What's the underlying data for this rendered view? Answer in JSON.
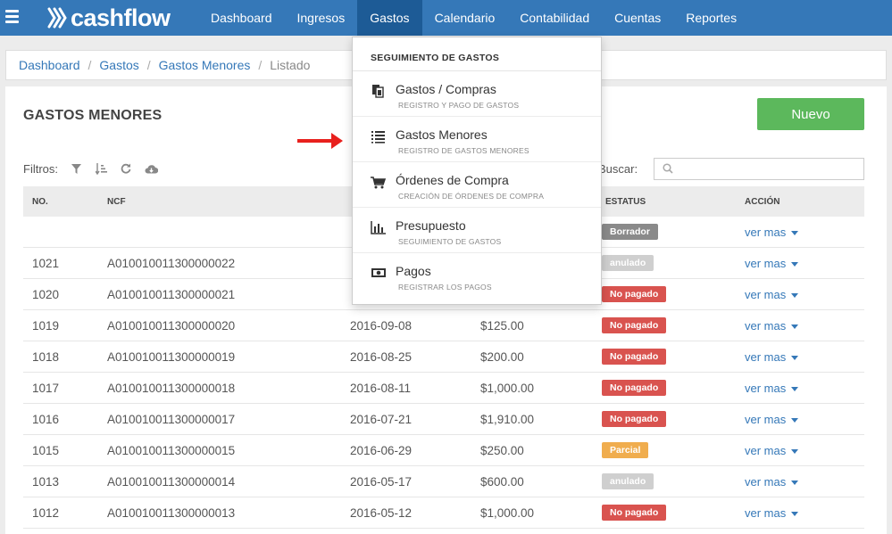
{
  "app": {
    "logo_text": "cashflow"
  },
  "nav": [
    {
      "label": "Dashboard",
      "active": false
    },
    {
      "label": "Ingresos",
      "active": false
    },
    {
      "label": "Gastos",
      "active": true
    },
    {
      "label": "Calendario",
      "active": false
    },
    {
      "label": "Contabilidad",
      "active": false
    },
    {
      "label": "Cuentas",
      "active": false
    },
    {
      "label": "Reportes",
      "active": false
    }
  ],
  "breadcrumb": {
    "items": [
      "Dashboard",
      "Gastos",
      "Gastos Menores"
    ],
    "current": "Listado"
  },
  "page": {
    "title": "GASTOS MENORES",
    "new_button": "Nuevo"
  },
  "filters": {
    "label": "Filtros:",
    "icons": [
      "filter-icon",
      "sort-icon",
      "refresh-icon",
      "cloud-download-icon"
    ]
  },
  "search": {
    "label": "Buscar:",
    "placeholder": ""
  },
  "table": {
    "headers": {
      "no": "NO.",
      "ncf": "NCF",
      "status": "ESTATUS",
      "action": "ACCIÓN"
    },
    "action_label": "ver mas",
    "rows": [
      {
        "no": "",
        "ncf": "",
        "date": "",
        "amount": "",
        "status": "Borrador"
      },
      {
        "no": "1021",
        "ncf": "A010010011300000022",
        "date": "",
        "amount": "",
        "status": "anulado"
      },
      {
        "no": "1020",
        "ncf": "A010010011300000021",
        "date": "",
        "amount": "",
        "status": "No pagado"
      },
      {
        "no": "1019",
        "ncf": "A010010011300000020",
        "date": "2016-09-08",
        "amount": "$125.00",
        "status": "No pagado"
      },
      {
        "no": "1018",
        "ncf": "A010010011300000019",
        "date": "2016-08-25",
        "amount": "$200.00",
        "status": "No pagado"
      },
      {
        "no": "1017",
        "ncf": "A010010011300000018",
        "date": "2016-08-11",
        "amount": "$1,000.00",
        "status": "No pagado"
      },
      {
        "no": "1016",
        "ncf": "A010010011300000017",
        "date": "2016-07-21",
        "amount": "$1,910.00",
        "status": "No pagado"
      },
      {
        "no": "1015",
        "ncf": "A010010011300000015",
        "date": "2016-06-29",
        "amount": "$250.00",
        "status": "Parcial"
      },
      {
        "no": "1013",
        "ncf": "A010010011300000014",
        "date": "2016-05-17",
        "amount": "$600.00",
        "status": "anulado"
      },
      {
        "no": "1012",
        "ncf": "A010010011300000013",
        "date": "2016-05-12",
        "amount": "$1,000.00",
        "status": "No pagado"
      }
    ]
  },
  "status_colors": {
    "Borrador": "#8a8a8a",
    "anulado": "#cfcfcf",
    "No pagado": "#d9534f",
    "Parcial": "#f0ad4e"
  },
  "dropdown": {
    "header": "SEGUIMIENTO DE GASTOS",
    "items": [
      {
        "icon": "document-copy-icon",
        "title": "Gastos / Compras",
        "subtitle": "REGISTRO Y PAGO DE GASTOS"
      },
      {
        "icon": "list-icon",
        "title": "Gastos Menores",
        "subtitle": "REGISTRO DE GASTOS MENORES"
      },
      {
        "icon": "shopping-cart-icon",
        "title": "Órdenes de Compra",
        "subtitle": "CREACIÓN DE ÓRDENES DE COMPRA"
      },
      {
        "icon": "bar-chart-icon",
        "title": "Presupuesto",
        "subtitle": "SEGUIMIENTO DE GASTOS"
      },
      {
        "icon": "money-icon",
        "title": "Pagos",
        "subtitle": "REGISTRAR LOS PAGOS"
      }
    ]
  },
  "colors": {
    "brand": "#3578b8",
    "nav_active": "#1d5b96",
    "success": "#5cb85c",
    "annotation_arrow": "#e8201d"
  }
}
